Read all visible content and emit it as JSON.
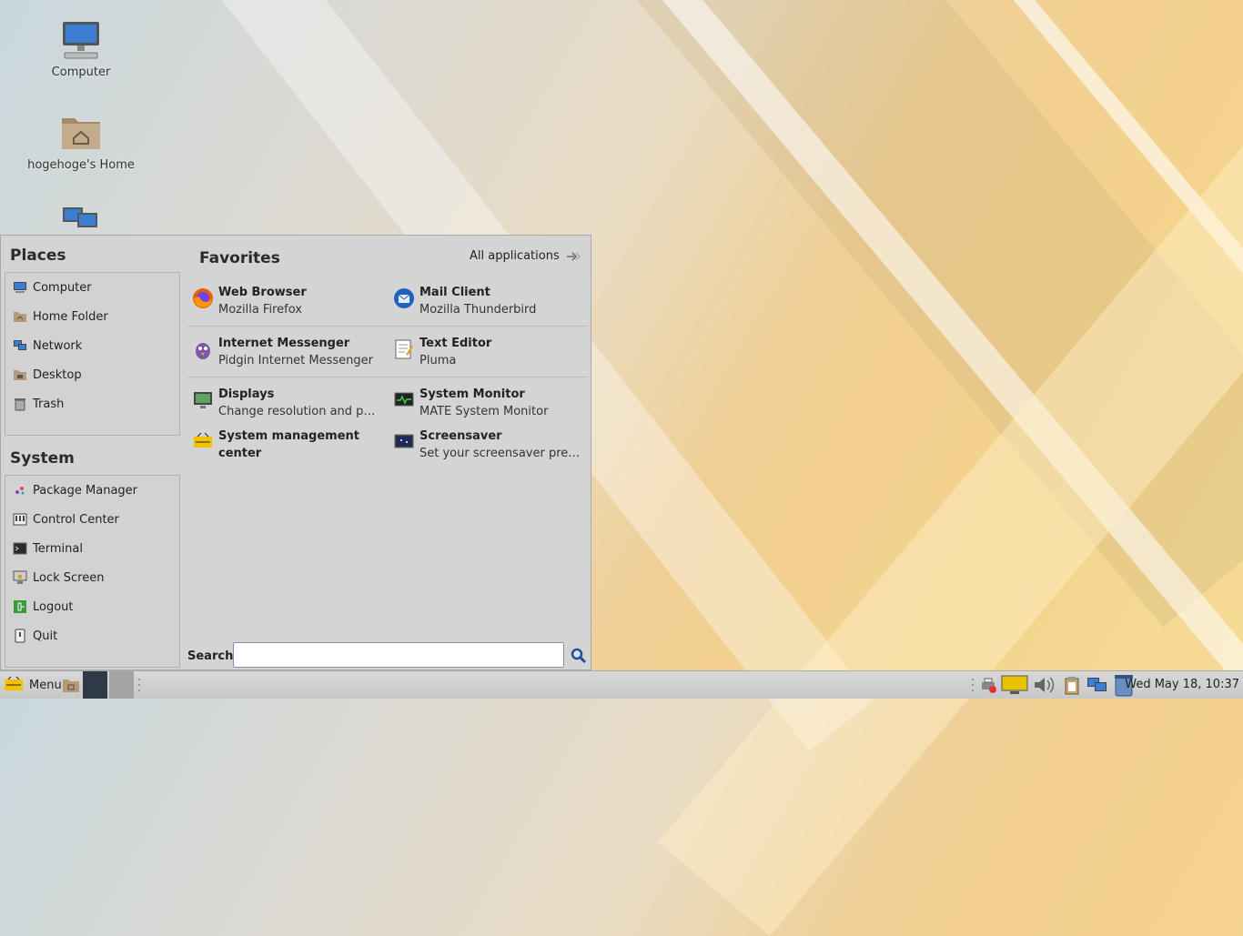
{
  "desktop": {
    "icons": [
      {
        "label": "Computer"
      },
      {
        "label": "hogehoge's Home"
      },
      {
        "label": ""
      }
    ]
  },
  "menu": {
    "places_title": "Places",
    "places": [
      {
        "label": "Computer",
        "icon": "computer-icon"
      },
      {
        "label": "Home Folder",
        "icon": "home-folder-icon"
      },
      {
        "label": "Network",
        "icon": "network-icon"
      },
      {
        "label": "Desktop",
        "icon": "desktop-folder-icon"
      },
      {
        "label": "Trash",
        "icon": "trash-icon"
      }
    ],
    "system_title": "System",
    "system": [
      {
        "label": "Package Manager",
        "icon": "package-manager-icon"
      },
      {
        "label": "Control Center",
        "icon": "control-center-icon"
      },
      {
        "label": "Terminal",
        "icon": "terminal-icon"
      },
      {
        "label": "Lock Screen",
        "icon": "lock-screen-icon"
      },
      {
        "label": "Logout",
        "icon": "logout-icon"
      },
      {
        "label": "Quit",
        "icon": "quit-icon"
      }
    ],
    "favorites_title": "Favorites",
    "all_applications": "All applications",
    "favorites": [
      {
        "name": "Web Browser",
        "desc": "Mozilla Firefox",
        "icon": "firefox-icon"
      },
      {
        "name": "Mail Client",
        "desc": "Mozilla Thunderbird",
        "icon": "thunderbird-icon"
      },
      {
        "name": "Internet Messenger",
        "desc": "Pidgin Internet Messenger",
        "icon": "pidgin-icon"
      },
      {
        "name": "Text Editor",
        "desc": "Pluma",
        "icon": "text-editor-icon"
      },
      {
        "name": "Displays",
        "desc": "Change resolution and position of monitors",
        "icon": "displays-icon"
      },
      {
        "name": "System Monitor",
        "desc": "MATE System Monitor",
        "icon": "system-monitor-icon"
      },
      {
        "name": "System management center",
        "desc": "",
        "icon": "alt-icon"
      },
      {
        "name": "Screensaver",
        "desc": "Set your screensaver preferences",
        "icon": "screensaver-icon"
      }
    ],
    "search_label": "Search:",
    "search_value": "",
    "search_placeholder": ""
  },
  "taskbar": {
    "menu_label": "Menu",
    "clock": "Wed May 18, 10:37"
  },
  "colors": {
    "menu_bg": "#d4d4d4",
    "taskbar_bg": "#cfcfcf",
    "search_border": "#7e93b6"
  }
}
